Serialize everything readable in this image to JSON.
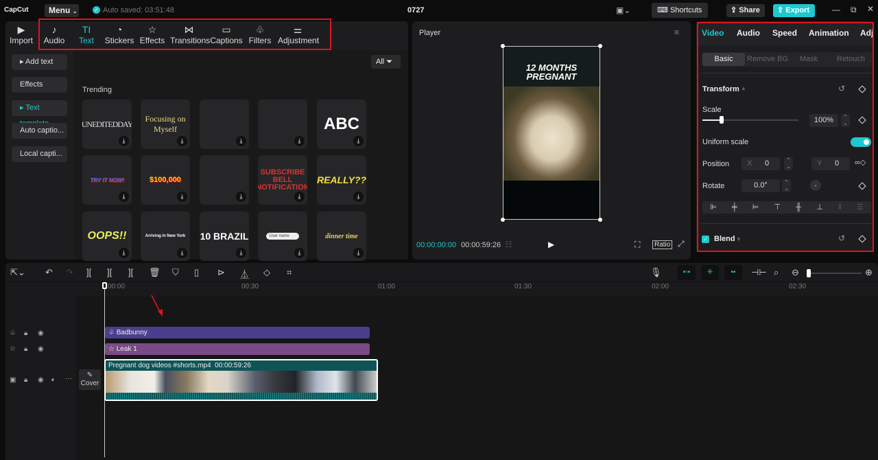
{
  "app": {
    "logo": "CapCut",
    "menu": "Menu",
    "autosave": "Auto saved: 03:51:48",
    "project": "0727",
    "shortcuts": "Shortcuts",
    "share": "Share",
    "export": "Export"
  },
  "media_tabs": [
    {
      "label": "Import",
      "icon": "import-icon"
    },
    {
      "label": "Audio",
      "icon": "audio-icon"
    },
    {
      "label": "Text",
      "icon": "text-icon"
    },
    {
      "label": "Stickers",
      "icon": "sticker-icon"
    },
    {
      "label": "Effects",
      "icon": "effects-icon"
    },
    {
      "label": "Transitions",
      "icon": "transitions-icon"
    },
    {
      "label": "Captions",
      "icon": "captions-icon"
    },
    {
      "label": "Filters",
      "icon": "filters-icon"
    },
    {
      "label": "Adjustment",
      "icon": "adjustment-icon"
    }
  ],
  "text_sidebar": [
    "Add text",
    "Effects",
    "Text template",
    "Auto captio...",
    "Local capti..."
  ],
  "filter_all": "All",
  "section_title": "Trending",
  "templates": [
    "UNEDITEDDAY",
    "Focusing on Myself",
    "",
    "",
    "ABC",
    "TRY IT NOW!",
    "$100,000",
    "",
    "SUBSCRIBE BELL NOTIFICATION",
    "REALLY??",
    "OOPS!!",
    "Arriving in New York",
    "10 BRAZIL",
    "User name",
    "dinner time"
  ],
  "player": {
    "title": "Player",
    "overlay_text": "12 MONTHS PREGNANT",
    "current_time": "00:00:00:00",
    "duration": "00:00:59:26",
    "ratio": "Ratio"
  },
  "inspector": {
    "tabs": [
      "Video",
      "Audio",
      "Speed",
      "Animation",
      "Adju"
    ],
    "subtabs": [
      "Basic",
      "Remove BG",
      "Mask",
      "Retouch"
    ],
    "transform": "Transform",
    "scale_label": "Scale",
    "scale_value": "100%",
    "scale_fraction": 0.2,
    "uniform_scale": "Uniform scale",
    "uniform_on": true,
    "position_label": "Position",
    "x_label": "X",
    "x_value": "0",
    "y_label": "Y",
    "y_value": "0",
    "rotate_label": "Rotate",
    "rotate_value": "0.0°",
    "blend": "Blend"
  },
  "timeline": {
    "ruler": [
      "00:00",
      "00:30",
      "01:00",
      "01:30",
      "02:00",
      "02:30"
    ],
    "tracks": {
      "filter": "Badbunny",
      "effect": "Leak 1",
      "video_name": "Pregnant dog videos #shorts.mp4",
      "video_duration": "00:00:59:26"
    },
    "cover": "Cover"
  },
  "colors": {
    "accent": "#1fc8cf",
    "filter_clip": "#4a3f8f",
    "effect_clip": "#7a4a86",
    "video_clip": "#0e5457",
    "highlight": "#e0141c"
  }
}
